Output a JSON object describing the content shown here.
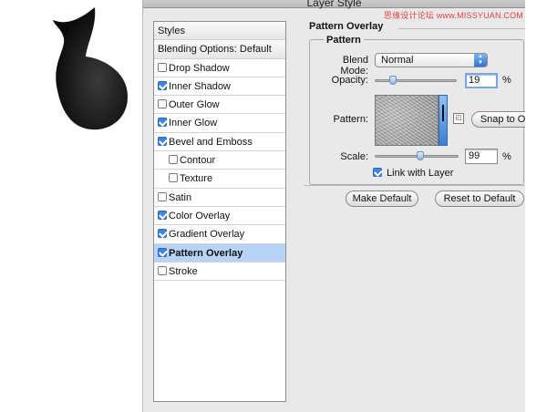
{
  "window": {
    "title": "Layer Style",
    "watermark": "思缘设计论坛 www.MISSYUAN.COM"
  },
  "styles_panel": {
    "header": "Styles",
    "blending_options": "Blending Options: Default",
    "items": [
      {
        "label": "Drop Shadow",
        "checked": false,
        "sub": false,
        "selected": false
      },
      {
        "label": "Inner Shadow",
        "checked": true,
        "sub": false,
        "selected": false
      },
      {
        "label": "Outer Glow",
        "checked": false,
        "sub": false,
        "selected": false
      },
      {
        "label": "Inner Glow",
        "checked": true,
        "sub": false,
        "selected": false
      },
      {
        "label": "Bevel and Emboss",
        "checked": true,
        "sub": false,
        "selected": false
      },
      {
        "label": "Contour",
        "checked": false,
        "sub": true,
        "selected": false
      },
      {
        "label": "Texture",
        "checked": false,
        "sub": true,
        "selected": false
      },
      {
        "label": "Satin",
        "checked": false,
        "sub": false,
        "selected": false
      },
      {
        "label": "Color Overlay",
        "checked": true,
        "sub": false,
        "selected": false
      },
      {
        "label": "Gradient Overlay",
        "checked": true,
        "sub": false,
        "selected": false
      },
      {
        "label": "Pattern Overlay",
        "checked": true,
        "sub": false,
        "selected": true
      },
      {
        "label": "Stroke",
        "checked": false,
        "sub": false,
        "selected": false
      }
    ]
  },
  "pattern_overlay": {
    "section_title": "Pattern Overlay",
    "group_title": "Pattern",
    "blend_mode_label": "Blend Mode:",
    "blend_mode_value": "Normal",
    "opacity_label": "Opacity:",
    "opacity_value": "19",
    "opacity_unit": "%",
    "opacity_level": 0.19,
    "pattern_label": "Pattern:",
    "snap_button": "Snap to Origin",
    "scale_label": "Scale:",
    "scale_value": "99",
    "scale_unit": "%",
    "scale_level": 0.55,
    "link_label": "Link with Layer",
    "link_checked": true,
    "make_default": "Make Default",
    "reset_default": "Reset to Default"
  },
  "colors": {
    "selected_row": "#b7d3f5",
    "accent": "#3d85de"
  },
  "icons": {
    "new_preset": "new-preset-icon",
    "picker": "pattern-picker-arrow-icon",
    "stepper": "blend-mode-stepper-icon"
  }
}
